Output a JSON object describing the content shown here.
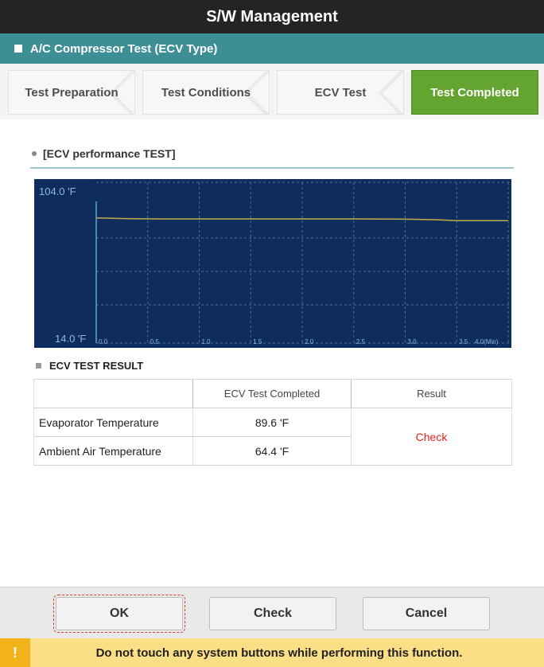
{
  "window": {
    "title": "S/W Management"
  },
  "section": {
    "title": "A/C Compressor Test (ECV Type)"
  },
  "steps": [
    {
      "label": "Test Preparation",
      "active": false
    },
    {
      "label": "Test Conditions",
      "active": false
    },
    {
      "label": "ECV Test",
      "active": false
    },
    {
      "label": "Test Completed",
      "active": true
    }
  ],
  "chart_section": {
    "title": "[ECV performance TEST]"
  },
  "chart_data": {
    "type": "line",
    "y_axis_labels": {
      "max": "104.0 'F",
      "min": "14.0 'F"
    },
    "ylim": [
      14.0,
      104.0
    ],
    "xlim": [
      0.0,
      4.0
    ],
    "x_tick_labels": [
      "0.0",
      "0.5",
      "1.0",
      "1.5",
      "2.0",
      "2.5",
      "3.0",
      "3.5",
      "4.0(Min)"
    ],
    "x_ticks": [
      0.0,
      0.5,
      1.0,
      1.5,
      2.0,
      2.5,
      3.0,
      3.5,
      4.0
    ],
    "grid": true,
    "background": "#0e2c5e",
    "series": [
      {
        "color": "#b8a24a",
        "x": [
          0.0,
          0.3,
          0.6,
          1.0,
          1.5,
          2.0,
          2.5,
          3.0,
          3.3,
          3.5,
          4.0
        ],
        "y": [
          95.0,
          94.5,
          94.3,
          94.3,
          94.3,
          94.3,
          94.3,
          94.2,
          93.8,
          93.2,
          93.2
        ]
      }
    ]
  },
  "result_section": {
    "title": "ECV TEST RESULT",
    "headers": [
      "",
      "ECV Test Completed",
      "Result"
    ],
    "rows": [
      {
        "label": "Evaporator Temperature",
        "value": "89.6 'F"
      },
      {
        "label": "Ambient Air Temperature",
        "value": "64.4 'F"
      }
    ],
    "result": "Check"
  },
  "buttons": {
    "ok": "OK",
    "check": "Check",
    "cancel": "Cancel"
  },
  "warning": {
    "icon": "!",
    "text": "Do not touch any system buttons while performing this function."
  },
  "colors": {
    "titlebar": "#222426",
    "section": "#3e8f95",
    "active_step": "#63a52f",
    "result_red": "#e0241c",
    "warning_bg": "#fbdf87"
  }
}
